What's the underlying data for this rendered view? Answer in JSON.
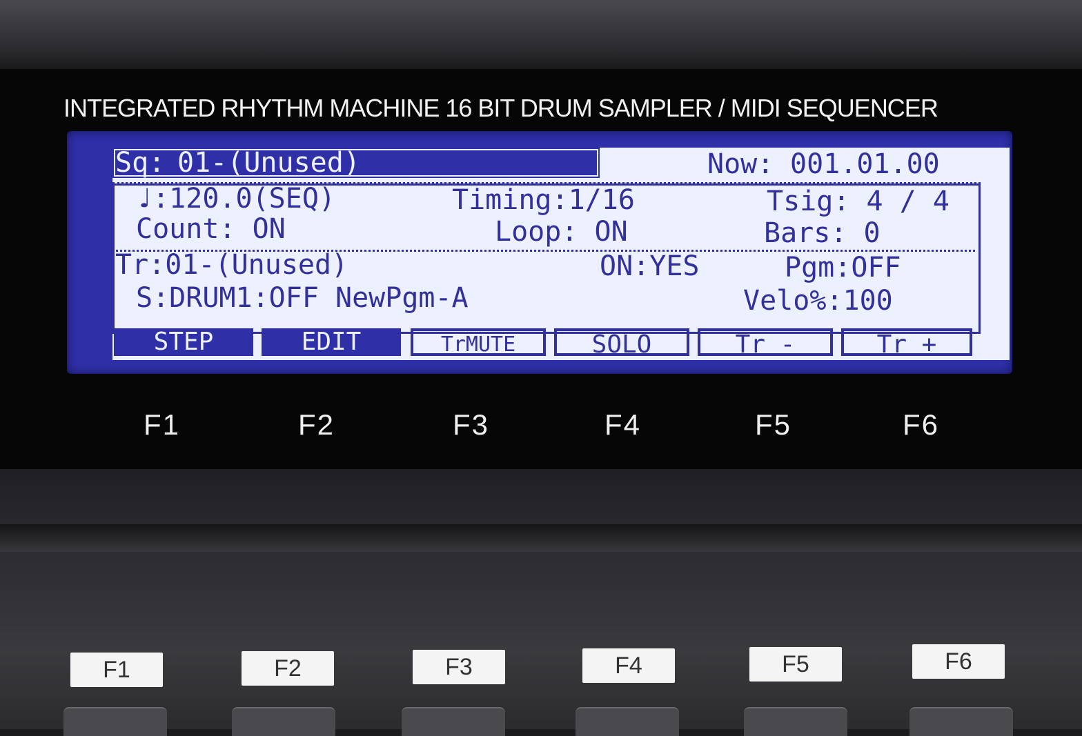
{
  "panel": {
    "header": "INTEGRATED RHYTHM MACHINE 16 BIT DRUM SAMPLER / MIDI SEQUENCER"
  },
  "lcd": {
    "sequence": {
      "label": "Sq:",
      "value": "01-(Unused)"
    },
    "now": {
      "label": "Now:",
      "value": "001.01.00"
    },
    "tempo": "♩:120.0(SEQ)",
    "timing": "Timing:1/16",
    "tsig": "Tsig: 4 / 4",
    "count": "Count: ON",
    "loop": "Loop: ON",
    "bars": "Bars: 0",
    "track": "Tr:01-(Unused)",
    "track_on": "ON:YES",
    "pgm": "Pgm:OFF",
    "sound": "S:DRUM1:OFF NewPgm-A",
    "velo": "Velo%:100",
    "softkeys": [
      "STEP",
      "EDIT",
      "TrMUTE",
      "SOLO",
      "Tr -",
      "Tr +"
    ]
  },
  "fkeys": [
    "F1",
    "F2",
    "F3",
    "F4",
    "F5",
    "F6"
  ],
  "button_labels": [
    "F1",
    "F2",
    "F3",
    "F4",
    "F5",
    "F6"
  ],
  "colors": {
    "lcd_bg": "#ecf0ff",
    "lcd_ink": "#32309a",
    "lcd_frame": "#2f2fa8"
  }
}
